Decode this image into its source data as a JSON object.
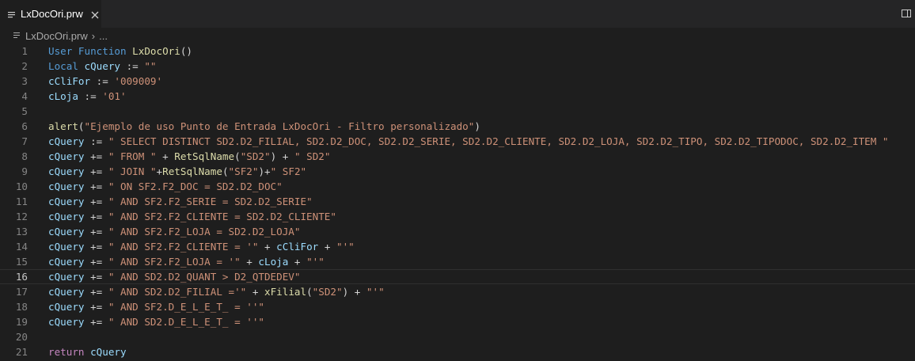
{
  "tab": {
    "label": "LxDocOri.prw"
  },
  "breadcrumb": {
    "file": "LxDocOri.prw",
    "more": "..."
  },
  "colors": {
    "keyword": "#569cd6",
    "control": "#c586c0",
    "function": "#dcdcaa",
    "variable": "#9cdcfe",
    "string": "#ce9178",
    "default": "#d4d4d4",
    "background": "#1e1e1e"
  },
  "editor": {
    "current_line": 16,
    "lines": [
      {
        "n": "1",
        "tokens": [
          [
            "kw",
            "User Function "
          ],
          [
            "fn",
            "LxDocOri"
          ],
          [
            "op",
            "()"
          ]
        ]
      },
      {
        "n": "2",
        "tokens": [
          [
            "kw",
            "Local "
          ],
          [
            "var",
            "cQuery"
          ],
          [
            "op",
            " := "
          ],
          [
            "str",
            "\"\""
          ]
        ]
      },
      {
        "n": "3",
        "tokens": [
          [
            "var",
            "cCliFor"
          ],
          [
            "op",
            " := "
          ],
          [
            "str",
            "'009009'"
          ]
        ]
      },
      {
        "n": "4",
        "tokens": [
          [
            "var",
            "cLoja"
          ],
          [
            "op",
            " := "
          ],
          [
            "str",
            "'01'"
          ]
        ]
      },
      {
        "n": "5",
        "tokens": []
      },
      {
        "n": "6",
        "tokens": [
          [
            "fn",
            "alert"
          ],
          [
            "op",
            "("
          ],
          [
            "str",
            "\"Ejemplo de uso Punto de Entrada LxDocOri - Filtro personalizado\""
          ],
          [
            "op",
            ")"
          ]
        ]
      },
      {
        "n": "7",
        "tokens": [
          [
            "var",
            "cQuery"
          ],
          [
            "op",
            " := "
          ],
          [
            "str",
            "\" SELECT DISTINCT SD2.D2_FILIAL, SD2.D2_DOC, SD2.D2_SERIE, SD2.D2_CLIENTE, SD2.D2_LOJA, SD2.D2_TIPO, SD2.D2_TIPODOC, SD2.D2_ITEM \""
          ]
        ]
      },
      {
        "n": "8",
        "tokens": [
          [
            "var",
            "cQuery"
          ],
          [
            "op",
            " += "
          ],
          [
            "str",
            "\" FROM \""
          ],
          [
            "op",
            " + "
          ],
          [
            "fn",
            "RetSqlName"
          ],
          [
            "op",
            "("
          ],
          [
            "str",
            "\"SD2\""
          ],
          [
            "op",
            ") + "
          ],
          [
            "str",
            "\" SD2\""
          ]
        ]
      },
      {
        "n": "9",
        "tokens": [
          [
            "var",
            "cQuery"
          ],
          [
            "op",
            " += "
          ],
          [
            "str",
            "\" JOIN \""
          ],
          [
            "op",
            "+"
          ],
          [
            "fn",
            "RetSqlName"
          ],
          [
            "op",
            "("
          ],
          [
            "str",
            "\"SF2\""
          ],
          [
            "op",
            ")+"
          ],
          [
            "str",
            "\" SF2\""
          ]
        ]
      },
      {
        "n": "10",
        "tokens": [
          [
            "var",
            "cQuery"
          ],
          [
            "op",
            " += "
          ],
          [
            "str",
            "\" ON SF2.F2_DOC = SD2.D2_DOC\""
          ]
        ]
      },
      {
        "n": "11",
        "tokens": [
          [
            "var",
            "cQuery"
          ],
          [
            "op",
            " += "
          ],
          [
            "str",
            "\" AND SF2.F2_SERIE = SD2.D2_SERIE\""
          ]
        ]
      },
      {
        "n": "12",
        "tokens": [
          [
            "var",
            "cQuery"
          ],
          [
            "op",
            " += "
          ],
          [
            "str",
            "\" AND SF2.F2_CLIENTE = SD2.D2_CLIENTE\""
          ]
        ]
      },
      {
        "n": "13",
        "tokens": [
          [
            "var",
            "cQuery"
          ],
          [
            "op",
            " += "
          ],
          [
            "str",
            "\" AND SF2.F2_LOJA = SD2.D2_LOJA\""
          ]
        ]
      },
      {
        "n": "14",
        "tokens": [
          [
            "var",
            "cQuery"
          ],
          [
            "op",
            " += "
          ],
          [
            "str",
            "\" AND SF2.F2_CLIENTE = '\""
          ],
          [
            "op",
            " + "
          ],
          [
            "var",
            "cCliFor"
          ],
          [
            "op",
            " + "
          ],
          [
            "str",
            "\"'\""
          ]
        ]
      },
      {
        "n": "15",
        "tokens": [
          [
            "var",
            "cQuery"
          ],
          [
            "op",
            " += "
          ],
          [
            "str",
            "\" AND SF2.F2_LOJA = '\""
          ],
          [
            "op",
            " + "
          ],
          [
            "var",
            "cLoja"
          ],
          [
            "op",
            " + "
          ],
          [
            "str",
            "\"'\""
          ]
        ]
      },
      {
        "n": "16",
        "tokens": [
          [
            "var",
            "cQuery"
          ],
          [
            "op",
            " += "
          ],
          [
            "str",
            "\" AND SD2.D2_QUANT > D2_QTDEDEV\""
          ]
        ]
      },
      {
        "n": "17",
        "tokens": [
          [
            "var",
            "cQuery"
          ],
          [
            "op",
            " += "
          ],
          [
            "str",
            "\" AND SD2.D2_FILIAL ='\""
          ],
          [
            "op",
            " + "
          ],
          [
            "fn",
            "xFilial"
          ],
          [
            "op",
            "("
          ],
          [
            "str",
            "\"SD2\""
          ],
          [
            "op",
            ") + "
          ],
          [
            "str",
            "\"'\""
          ]
        ]
      },
      {
        "n": "18",
        "tokens": [
          [
            "var",
            "cQuery"
          ],
          [
            "op",
            " += "
          ],
          [
            "str",
            "\" AND SF2.D_E_L_E_T_ = ''\""
          ]
        ]
      },
      {
        "n": "19",
        "tokens": [
          [
            "var",
            "cQuery"
          ],
          [
            "op",
            " += "
          ],
          [
            "str",
            "\" AND SD2.D_E_L_E_T_ = ''\""
          ]
        ]
      },
      {
        "n": "20",
        "tokens": []
      },
      {
        "n": "21",
        "tokens": [
          [
            "ctl",
            "return "
          ],
          [
            "var",
            "cQuery"
          ]
        ]
      }
    ]
  }
}
